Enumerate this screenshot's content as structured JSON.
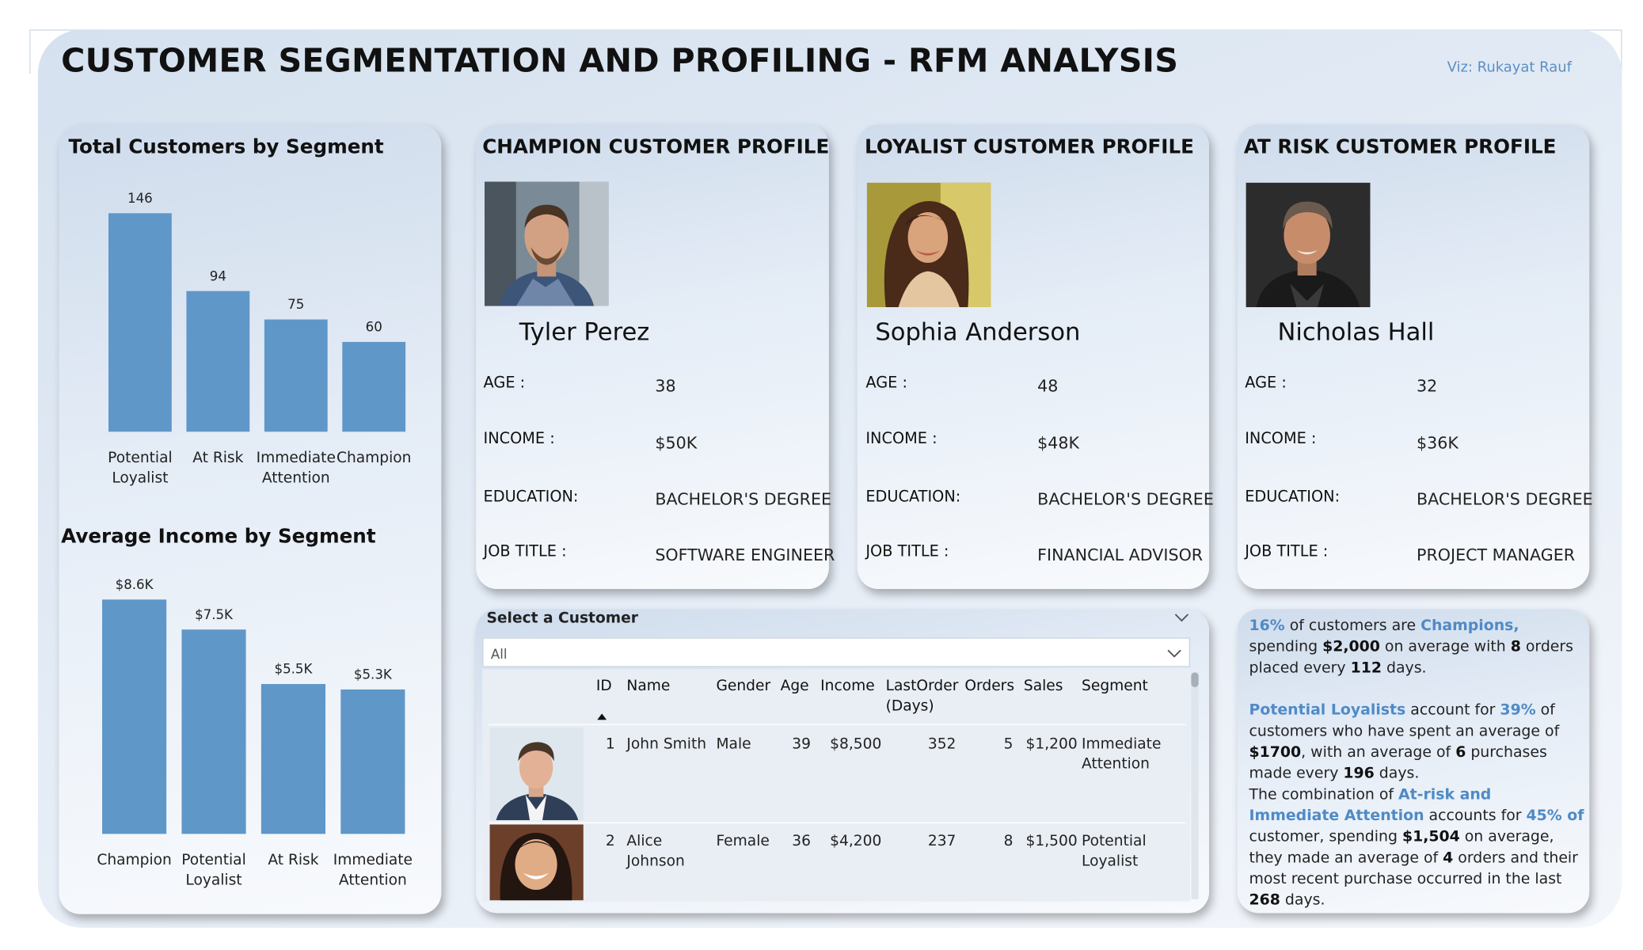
{
  "header": {
    "title": "CUSTOMER SEGMENTATION AND PROFILING - RFM ANALYSIS",
    "credit": "Viz: Rukayat Rauf"
  },
  "colors": {
    "bar": "#5f97c9",
    "accent": "#4f8ac6"
  },
  "chart_data": [
    {
      "type": "bar",
      "title": "Total Customers by Segment",
      "categories": [
        "Potential Loyalist",
        "At Risk",
        "Immediate Attention",
        "Champion"
      ],
      "category_lines": [
        [
          "Potential",
          "Loyalist"
        ],
        [
          "At Risk"
        ],
        [
          "Immediate",
          "Attention"
        ],
        [
          "Champion"
        ]
      ],
      "values": [
        146,
        94,
        75,
        60
      ],
      "value_labels": [
        "146",
        "94",
        "75",
        "60"
      ],
      "ylim": [
        0,
        146
      ]
    },
    {
      "type": "bar",
      "title": "Average Income by Segment",
      "categories": [
        "Champion",
        "Potential Loyalist",
        "At Risk",
        "Immediate Attention"
      ],
      "category_lines": [
        [
          "Champion"
        ],
        [
          "Potential",
          "Loyalist"
        ],
        [
          "At Risk"
        ],
        [
          "Immediate",
          "Attention"
        ]
      ],
      "values": [
        8600,
        7500,
        5500,
        5300
      ],
      "value_labels": [
        "$8.6K",
        "$7.5K",
        "$5.5K",
        "$5.3K"
      ],
      "ylim": [
        0,
        8600
      ]
    }
  ],
  "profile_labels": {
    "age": "AGE :",
    "income": "INCOME :",
    "education": "EDUCATION:",
    "job": "JOB TITLE :"
  },
  "profiles": [
    {
      "title": "CHAMPION CUSTOMER PROFILE",
      "name": "Tyler Perez",
      "age": "38",
      "income": "$50K",
      "education": "BACHELOR'S DEGREE",
      "job": "SOFTWARE ENGINEER"
    },
    {
      "title": "LOYALIST CUSTOMER PROFILE",
      "name": "Sophia Anderson",
      "age": "48",
      "income": "$48K",
      "education": "BACHELOR'S DEGREE",
      "job": "FINANCIAL ADVISOR"
    },
    {
      "title": "AT RISK CUSTOMER PROFILE",
      "name": "Nicholas Hall",
      "age": "32",
      "income": "$36K",
      "education": "BACHELOR'S DEGREE",
      "job": "PROJECT MANAGER"
    }
  ],
  "slicer": {
    "title": "Select a Customer",
    "selected": "All"
  },
  "table": {
    "columns": {
      "id": "ID",
      "name": "Name",
      "gender": "Gender",
      "age": "Age",
      "income": "Income",
      "lastorder_1": "LastOrder",
      "lastorder_2": "(Days)",
      "orders": "Orders",
      "sales": "Sales",
      "segment": "Segment"
    },
    "rows": [
      {
        "id": "1",
        "name_1": "John Smith",
        "name_2": "",
        "gender": "Male",
        "age": "39",
        "income": "$8,500",
        "lastorder": "352",
        "orders": "5",
        "sales": "$1,200",
        "segment_1": "Immediate",
        "segment_2": "Attention"
      },
      {
        "id": "2",
        "name_1": "Alice",
        "name_2": "Johnson",
        "gender": "Female",
        "age": "36",
        "income": "$4,200",
        "lastorder": "237",
        "orders": "8",
        "sales": "$1,500",
        "segment_1": "Potential",
        "segment_2": "Loyalist"
      }
    ]
  },
  "insights": {
    "p1": {
      "a": "16%",
      "b": " of customers are ",
      "c": "Champions,",
      "d": " spending ",
      "e": "$2,000",
      "f": " on average with ",
      "g": "8",
      "h": " orders placed every ",
      "i": "112",
      "j": " days."
    },
    "p2": {
      "a": "Potential Loyalists",
      "b": " account for ",
      "c": "39%",
      "d": " of customers who have spent an average of ",
      "e": "$1700",
      "f": ", with an average of ",
      "g": "6",
      "h": " purchases made every ",
      "i": "196",
      "j": " days."
    },
    "p3": {
      "a": "The combination of ",
      "b": "At-risk and Immediate Attention",
      "c": " accounts for ",
      "d": "45% of",
      "e": " customer, spending ",
      "f": "$1,504",
      "g": " on average, they made an average of ",
      "h": "4",
      "i": " orders and their most recent purchase occurred in the last ",
      "j": "268",
      "k": " days."
    }
  }
}
